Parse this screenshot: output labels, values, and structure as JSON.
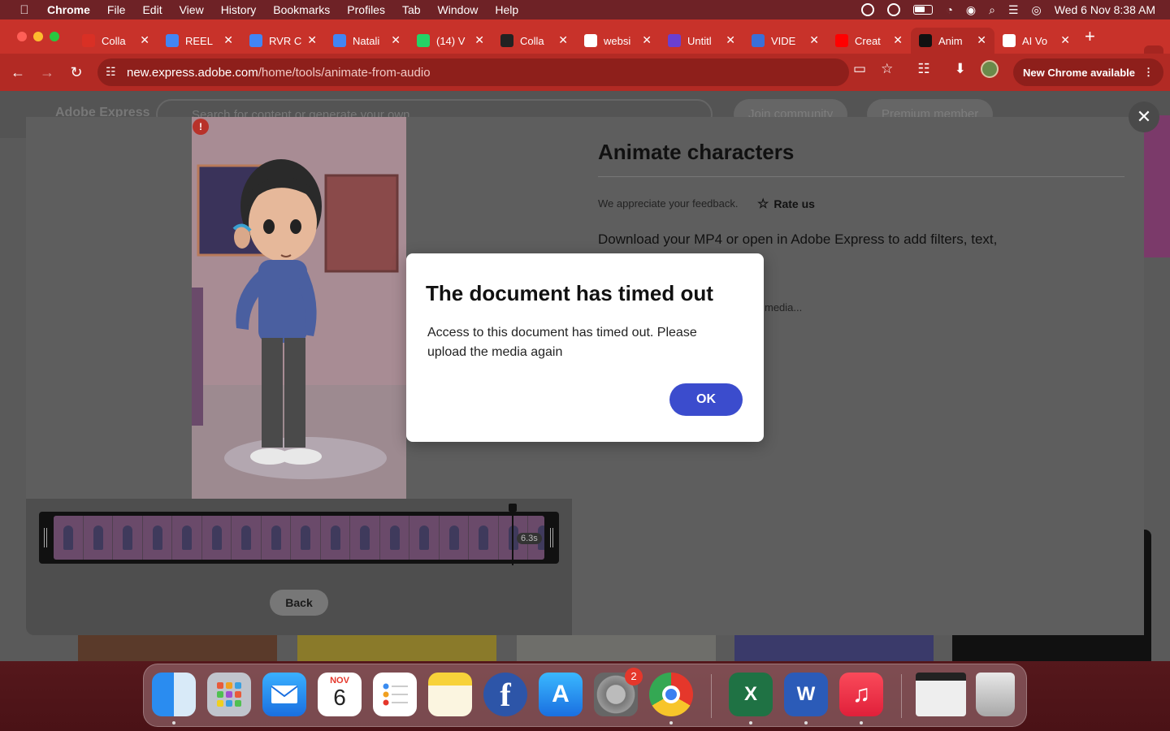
{
  "menubar": {
    "app": "Chrome",
    "items": [
      "File",
      "Edit",
      "View",
      "History",
      "Bookmarks",
      "Profiles",
      "Tab",
      "Window",
      "Help"
    ],
    "clock": "Wed 6 Nov  8:38 AM"
  },
  "tabs": [
    {
      "label": "Colla",
      "icon": "gmail-icon",
      "color": "#d93025"
    },
    {
      "label": "REEL",
      "icon": "docs-icon",
      "color": "#4285f4"
    },
    {
      "label": "RVR C",
      "icon": "docs-icon",
      "color": "#4285f4"
    },
    {
      "label": "Natali",
      "icon": "docs-icon",
      "color": "#4285f4"
    },
    {
      "label": "(14) V",
      "icon": "whatsapp-icon",
      "color": "#25d366"
    },
    {
      "label": "Colla",
      "icon": "openai-icon",
      "color": "#222222"
    },
    {
      "label": "websi",
      "icon": "google-icon",
      "color": "#ffffff"
    },
    {
      "label": "Untitl",
      "icon": "video-icon",
      "color": "#6a3fd1"
    },
    {
      "label": "VIDE",
      "icon": "translate-icon",
      "color": "#3a6fd8"
    },
    {
      "label": "Creat",
      "icon": "youtube-icon",
      "color": "#ff0000"
    },
    {
      "label": "Anim",
      "icon": "adobe-icon",
      "color": "#111111",
      "active": true
    },
    {
      "label": "AI Vo",
      "icon": "ai-icon",
      "color": "#ffffff"
    }
  ],
  "address": {
    "host": "new.express.adobe.com",
    "path": "/home/tools/animate-from-audio"
  },
  "new_chrome": "New Chrome available",
  "background_page": {
    "brand": "Adobe Express",
    "search_placeholder": "Search for content or generate your own",
    "join": "Join community",
    "premium": "Premium member"
  },
  "panel": {
    "title": "Animate characters",
    "feedback": "We appreciate your feedback.",
    "rate": "Rate us",
    "description": "Download your MP4 or open in Adobe Express to add filters, text,",
    "media_status": "media...",
    "duration": "6.3s",
    "back": "Back"
  },
  "dialog": {
    "title": "The document has timed out",
    "message": "Access to this document has timed out. Please upload the media again",
    "ok": "OK"
  },
  "dock": {
    "calendar_month": "NOV",
    "calendar_day": "6",
    "settings_badge": "2",
    "apps": [
      "Finder",
      "Launchpad",
      "Mail",
      "Calendar",
      "Reminders",
      "Notes",
      "Facebook",
      "App Store",
      "System Settings",
      "Chrome",
      "Excel",
      "Word",
      "Music",
      "Screenshot",
      "Trash"
    ]
  }
}
